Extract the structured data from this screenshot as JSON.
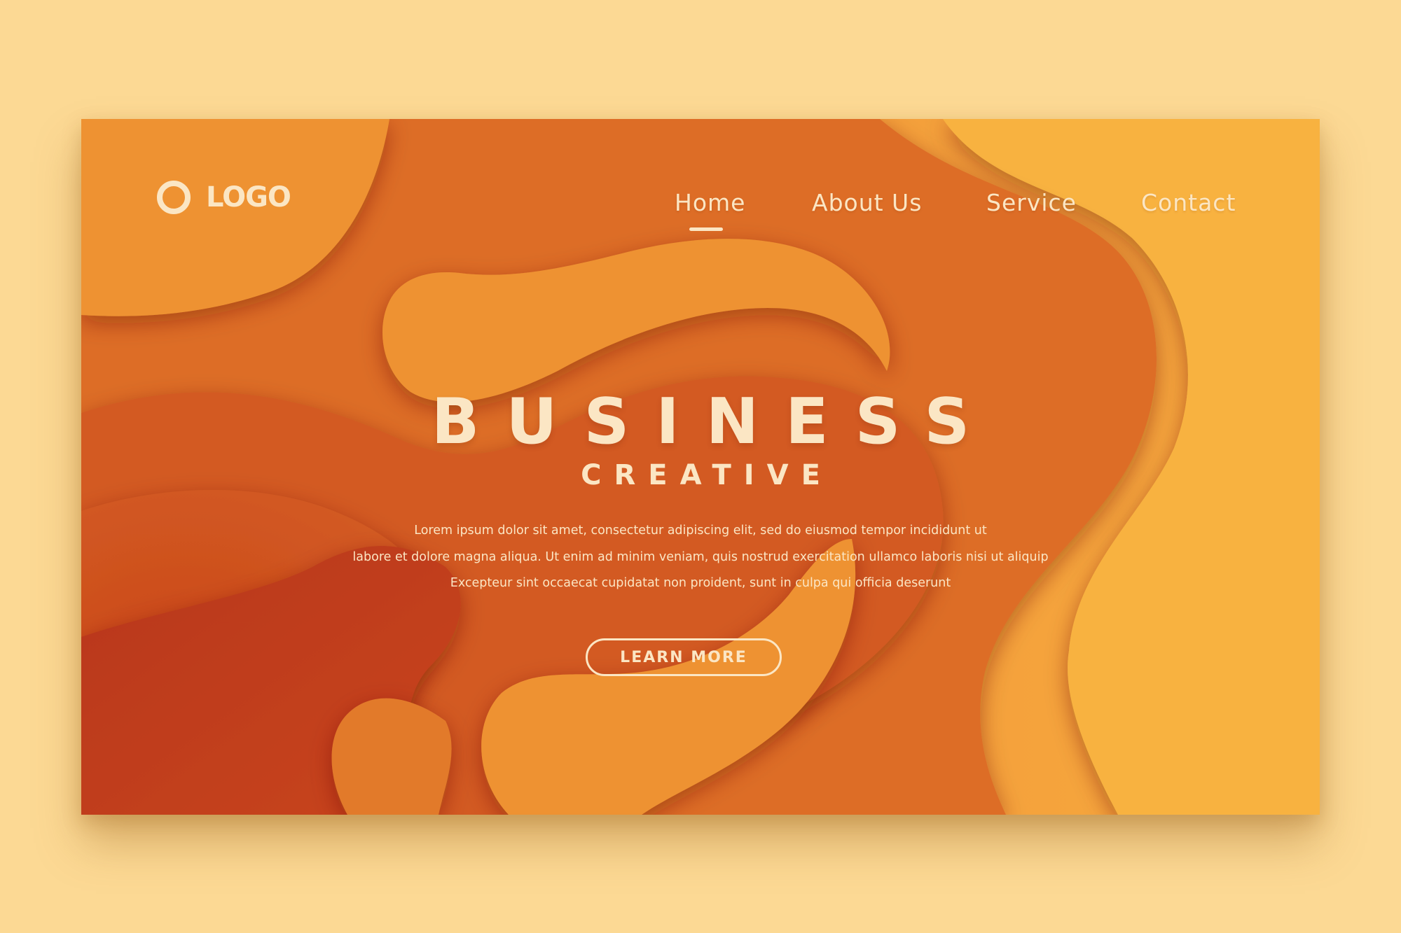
{
  "colors": {
    "page_background": "#fcd994",
    "text_light": "#fbe6c4",
    "accent_light": "#f8b241",
    "accent_mid": "#ee9232",
    "accent_dark": "#c5461c"
  },
  "header": {
    "logo_icon": "ring-icon",
    "logo_text": "LOGO",
    "nav": [
      {
        "label": "Home",
        "active": true
      },
      {
        "label": "About Us",
        "active": false
      },
      {
        "label": "Service",
        "active": false
      },
      {
        "label": "Contact",
        "active": false
      }
    ]
  },
  "hero": {
    "title": "BUSINESS",
    "subtitle": "CREATIVE",
    "body_lines": [
      "Lorem ipsum dolor sit amet, consectetur adipiscing elit, sed do eiusmod tempor incididunt ut",
      "labore et dolore magna aliqua. Ut enim ad minim veniam, quis nostrud exercitation ullamco laboris nisi ut aliquip",
      "Excepteur sint occaecat cupidatat non proident, sunt in culpa qui officia deserunt"
    ],
    "cta_label": "LEARN MORE"
  }
}
